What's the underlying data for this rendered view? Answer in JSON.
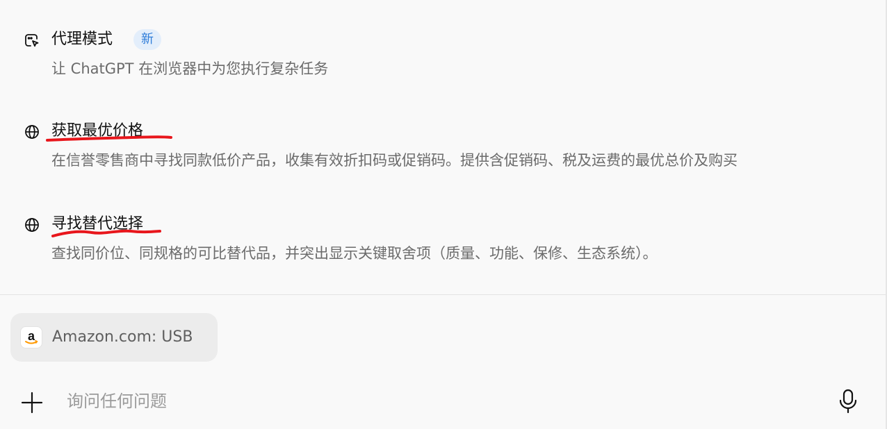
{
  "suggestions": [
    {
      "icon": "agent-mode-icon",
      "title": "代理模式",
      "badge": "新",
      "description": "让 ChatGPT 在浏览器中为您执行复杂任务"
    },
    {
      "icon": "globe-icon",
      "title": "获取最优价格",
      "description": "在信誉零售商中寻找同款低价产品，收集有效折扣码或促销码。提供含促销码、税及运费的最优总价及购买"
    },
    {
      "icon": "globe-icon",
      "title": "寻找替代选择",
      "description": "查找同价位、同规格的可比替代品，并突出显示关键取舍项（质量、功能、保修、生态系统）。"
    }
  ],
  "context_chip": {
    "icon": "amazon-logo-icon",
    "label": "Amazon.com: USB"
  },
  "composer": {
    "placeholder": "询问任何问题",
    "add_icon": "plus-icon",
    "mic_icon": "microphone-icon"
  },
  "colors": {
    "background": "#f9f9f9",
    "badge_bg": "#e3eefb",
    "badge_text": "#2f7dd9",
    "annotation_underline": "#e8161c",
    "amazon_smile": "#ff9900"
  }
}
